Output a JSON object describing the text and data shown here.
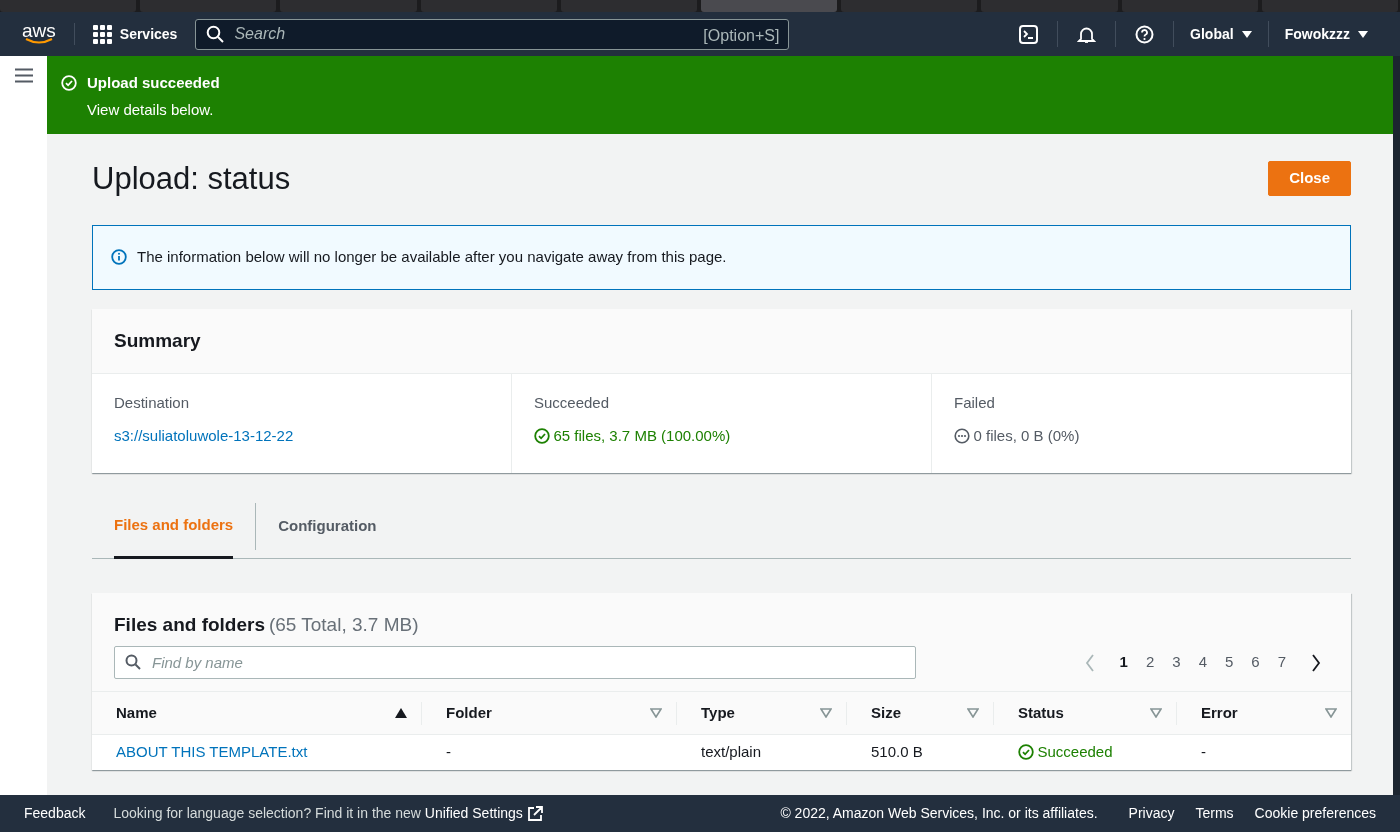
{
  "browser_tabs": [
    {
      "selected": false
    },
    {
      "selected": false
    },
    {
      "selected": false
    },
    {
      "selected": false
    },
    {
      "selected": false
    },
    {
      "selected": true
    },
    {
      "selected": false
    },
    {
      "selected": false
    },
    {
      "selected": false
    },
    {
      "selected": false
    }
  ],
  "nav": {
    "logo": "aws",
    "services": "Services",
    "search": {
      "placeholder": "Search",
      "shortcut": "[Option+S]"
    },
    "region": "Global",
    "account": "Fowokzzz"
  },
  "flash": {
    "title": "Upload succeeded",
    "message": "View details below."
  },
  "page": {
    "title": "Upload: status",
    "close_button": "Close"
  },
  "info_alert": "The information below will no longer be available after you navigate away from this page.",
  "summary": {
    "title": "Summary",
    "items": [
      {
        "label": "Destination",
        "value": "s3://suliatoluwole-13-12-22",
        "kind": "link"
      },
      {
        "label": "Succeeded",
        "value": "65 files, 3.7 MB (100.00%)",
        "kind": "success"
      },
      {
        "label": "Failed",
        "value": "0 files, 0 B (0%)",
        "kind": "neutral"
      }
    ]
  },
  "tabs": [
    {
      "label": "Files and folders",
      "selected": true
    },
    {
      "label": "Configuration",
      "selected": false
    }
  ],
  "files": {
    "title": "Files and folders",
    "count": "(65 Total, 3.7 MB)",
    "search": {
      "placeholder": "Find by name"
    },
    "pagination": {
      "prev_disabled": true,
      "pages": [
        {
          "label": "1",
          "selected": true
        },
        {
          "label": "2",
          "selected": false
        },
        {
          "label": "3",
          "selected": false
        },
        {
          "label": "4",
          "selected": false
        },
        {
          "label": "5",
          "selected": false
        },
        {
          "label": "6",
          "selected": false
        },
        {
          "label": "7",
          "selected": false
        }
      ]
    },
    "columns": [
      {
        "label": "Name",
        "sorted": true
      },
      {
        "label": "Folder",
        "sorted": false
      },
      {
        "label": "Type",
        "sorted": false
      },
      {
        "label": "Size",
        "sorted": false
      },
      {
        "label": "Status",
        "sorted": false
      },
      {
        "label": "Error",
        "sorted": false
      }
    ],
    "rows": [
      {
        "name": "ABOUT THIS TEMPLATE.txt",
        "folder": "-",
        "type": "text/plain",
        "size": "510.0 B",
        "status": "Succeeded",
        "error": "-"
      }
    ]
  },
  "footer": {
    "feedback": "Feedback",
    "notice": "Looking for language selection? Find it in the new ",
    "notice_link": "Unified Settings",
    "copyright": "© 2022, Amazon Web Services, Inc. or its affiliates.",
    "links": [
      "Privacy",
      "Terms",
      "Cookie preferences"
    ]
  }
}
